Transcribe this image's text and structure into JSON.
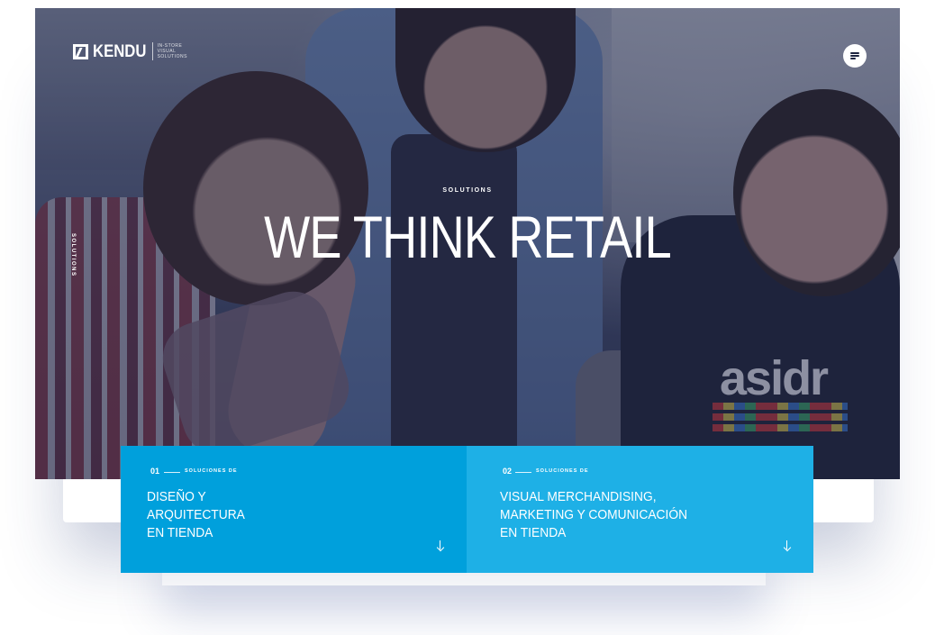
{
  "header": {
    "logo_text": "KENDU",
    "logo_tagline": [
      "IN-STORE",
      "VISUAL",
      "SOLUTIONS"
    ],
    "menu_icon": "menu-lines-icon"
  },
  "hero": {
    "side_label": "SOLUTIONS",
    "eyebrow": "SOLUTIONS",
    "title": "WE THINK RETAIL"
  },
  "cards": [
    {
      "number": "01",
      "kicker": "SOLUCIONES DE",
      "title_lines": [
        "DISEÑO Y",
        "ARQUITECTURA",
        "EN TIENDA"
      ],
      "arrow_icon": "arrow-down-icon"
    },
    {
      "number": "02",
      "kicker": "SOLUCIONES DE",
      "title_lines": [
        "VISUAL MERCHANDISING,",
        "MARKETING Y COMUNICACIÓN",
        "EN TIENDA"
      ],
      "arrow_icon": "arrow-down-icon"
    }
  ],
  "colors": {
    "card_1_bg": "#00a0dc",
    "card_2_bg": "#1eb0e6",
    "overlay": "#1c2242"
  }
}
